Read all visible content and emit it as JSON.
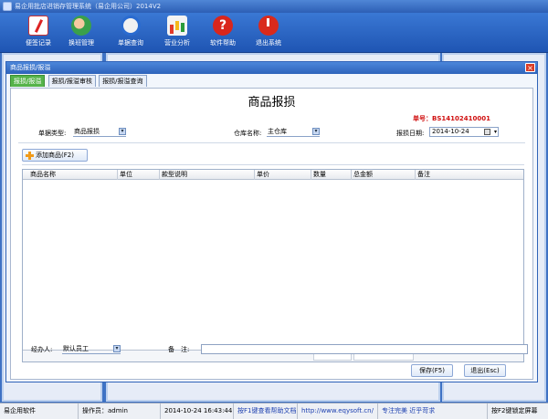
{
  "app": {
    "title": "易企用批店进销存管理系统（易企用公司）2014V2"
  },
  "toolbar": {
    "items": [
      {
        "label": "便签记录",
        "icon": "note-icon"
      },
      {
        "label": "换班管理",
        "icon": "shift-icon"
      },
      {
        "label": "单据查询",
        "icon": "search-icon"
      },
      {
        "label": "营业分析",
        "icon": "bar-chart-icon"
      },
      {
        "label": "软件帮助",
        "icon": "help-icon"
      },
      {
        "label": "退出系统",
        "icon": "power-icon"
      }
    ]
  },
  "dialog": {
    "title": "商品报损/报溢",
    "close_glyph": "×",
    "tabs": [
      "报损/报溢",
      "报损/报溢审核",
      "报损/报溢查询"
    ],
    "form_title": "商品报损",
    "order_no": "单号：BS14102410001",
    "filters": {
      "type_label": "单据类型:",
      "type_value": "商品报损",
      "warehouse_label": "仓库名称:",
      "warehouse_value": "主仓库",
      "date_label": "报损日期:",
      "date_value": "2014-10-24"
    },
    "add_button": "添加商品(F2)",
    "columns": [
      "商品名称",
      "单位",
      "款型说明",
      "单价",
      "数量",
      "总金额",
      "备注"
    ],
    "handler_label": "经办人:",
    "handler_value": "默认员工",
    "remark_label": "备　注:",
    "remark_value": "",
    "save_button": "保存(F5)",
    "exit_button": "退出(Esc)"
  },
  "statusbar": {
    "company": "易企用软件",
    "operator": "操作员：admin",
    "datetime": "2014-10-24 16:43:44",
    "help_hint": "按F1键查看帮助文档",
    "website": "http://www.eqysoft.cn/",
    "slogan": "专注完美  近乎苛求",
    "lock_hint": "按F2键锁定屏幕"
  }
}
